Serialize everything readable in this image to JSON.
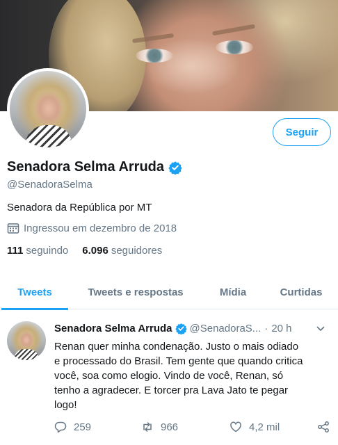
{
  "profile": {
    "follow_label": "Seguir",
    "name": "Senadora Selma Arruda",
    "handle": "@SenadoraSelma",
    "bio": "Senadora da República por MT",
    "joined": "Ingressou em dezembro de 2018",
    "following_count": "111",
    "following_label": "seguindo",
    "followers_count": "6.096",
    "followers_label": "seguidores"
  },
  "tabs": [
    {
      "label": "Tweets",
      "active": true
    },
    {
      "label": "Tweets e respostas"
    },
    {
      "label": "Mídia"
    },
    {
      "label": "Curtidas"
    }
  ],
  "tweet": {
    "name": "Senadora Selma Arruda",
    "handle": "@SenadoraS...",
    "dot": "·",
    "time": "20 h",
    "text": "Renan quer minha condenação.  Justo o mais odiado\ne processado do Brasil.  Tem gente que quando critica\nvocê, soa como elogio.  Vindo de você,  Renan, só\ntenho a agradecer. E torcer pra Lava Jato te pegar\nlogo!",
    "replies": "259",
    "retweets": "966",
    "likes": "4,2 mil"
  },
  "colors": {
    "accent": "#1da1f2",
    "muted": "#657786",
    "text": "#14171a"
  },
  "icons": [
    "verified-badge-icon",
    "calendar-icon",
    "chevron-down-icon",
    "reply-icon",
    "retweet-icon",
    "like-icon",
    "share-icon"
  ]
}
